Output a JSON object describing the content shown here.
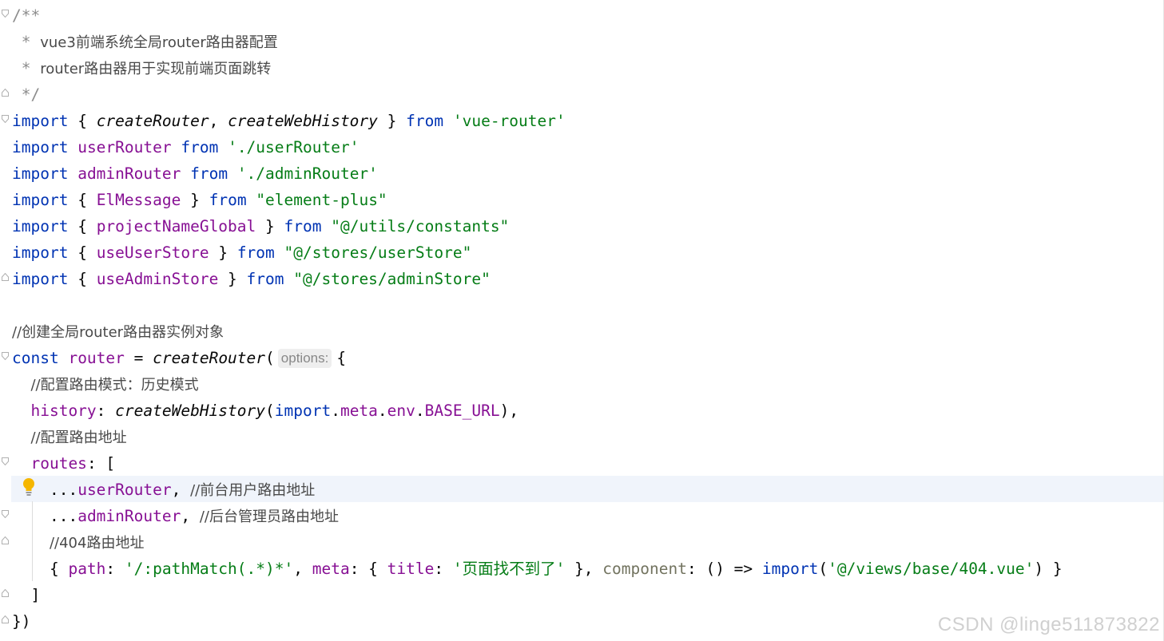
{
  "code": {
    "doc_open": "/**",
    "doc_line1_prefix": " * ",
    "doc_line1": "vue3前端系统全局router路由器配置",
    "doc_line2_prefix": " * ",
    "doc_line2": "router路由器用于实现前端页面跳转",
    "doc_close": " */",
    "kw_import": "import",
    "kw_from": "from",
    "kw_const": "const",
    "l5": {
      "open": " { ",
      "a": "createRouter",
      "sep": ", ",
      "b": "createWebHistory",
      "close": " } ",
      "str": "'vue-router'"
    },
    "l6": {
      "name": "userRouter",
      "str": "'./userRouter'"
    },
    "l7": {
      "name": "adminRouter",
      "str": "'./adminRouter'"
    },
    "l8": {
      "name": "ElMessage",
      "str": "\"element-plus\""
    },
    "l9": {
      "name": "projectNameGlobal",
      "str": "\"@/utils/constants\""
    },
    "l10": {
      "name": "useUserStore",
      "str": "\"@/stores/userStore\""
    },
    "l11": {
      "name": "useAdminStore",
      "str": "\"@/stores/adminStore\""
    },
    "comment_create": "//创建全局router路由器实例对象",
    "l14": {
      "var": "router",
      "eq": " = ",
      "fn": "createRouter",
      "paren": "(",
      "hint": "options:",
      "brace": "{"
    },
    "comment_mode": "//配置路由模式：历史模式",
    "l16": {
      "prop": "history",
      "colon": ": ",
      "fn": "createWebHistory",
      "p1": "(",
      "kw": "import",
      "dot1": ".",
      "meta": "meta",
      "dot2": ".",
      "env": "env",
      "dot3": ".",
      "base": "BASE_URL",
      "p2": "),"
    },
    "comment_addr": "//配置路由地址",
    "l18": {
      "prop": "routes",
      "rest": ": ["
    },
    "l19": {
      "spread": "...",
      "name": "userRouter",
      "comma": ", ",
      "comment": "//前台用户路由地址"
    },
    "l20": {
      "spread": "...",
      "name": "adminRouter",
      "comma": ", ",
      "comment": "//后台管理员路由地址"
    },
    "comment_404": "//404路由地址",
    "l22": {
      "open": "{ ",
      "path": "path",
      "c1": ": ",
      "path_val": "'/:pathMatch(.*)*'",
      "sep1": ", ",
      "meta": "meta",
      "c2": ": { ",
      "title": "title",
      "c3": ": ",
      "title_val": "'页面找不到了'",
      "close1": " }, ",
      "component": "component",
      "c4": ": () => ",
      "kw": "import",
      "p1": "(",
      "comp_val": "'@/views/base/404.vue'",
      "p2": ") }"
    },
    "l23": "]",
    "l24": "})"
  },
  "watermark": "CSDN @linge511873822",
  "colors": {
    "keyword": "#0033b3",
    "string": "#067d17",
    "variable": "#871094",
    "comment": "#8c8c8c",
    "highlight": "#f0f4fb",
    "bulb": "#f5b600"
  }
}
